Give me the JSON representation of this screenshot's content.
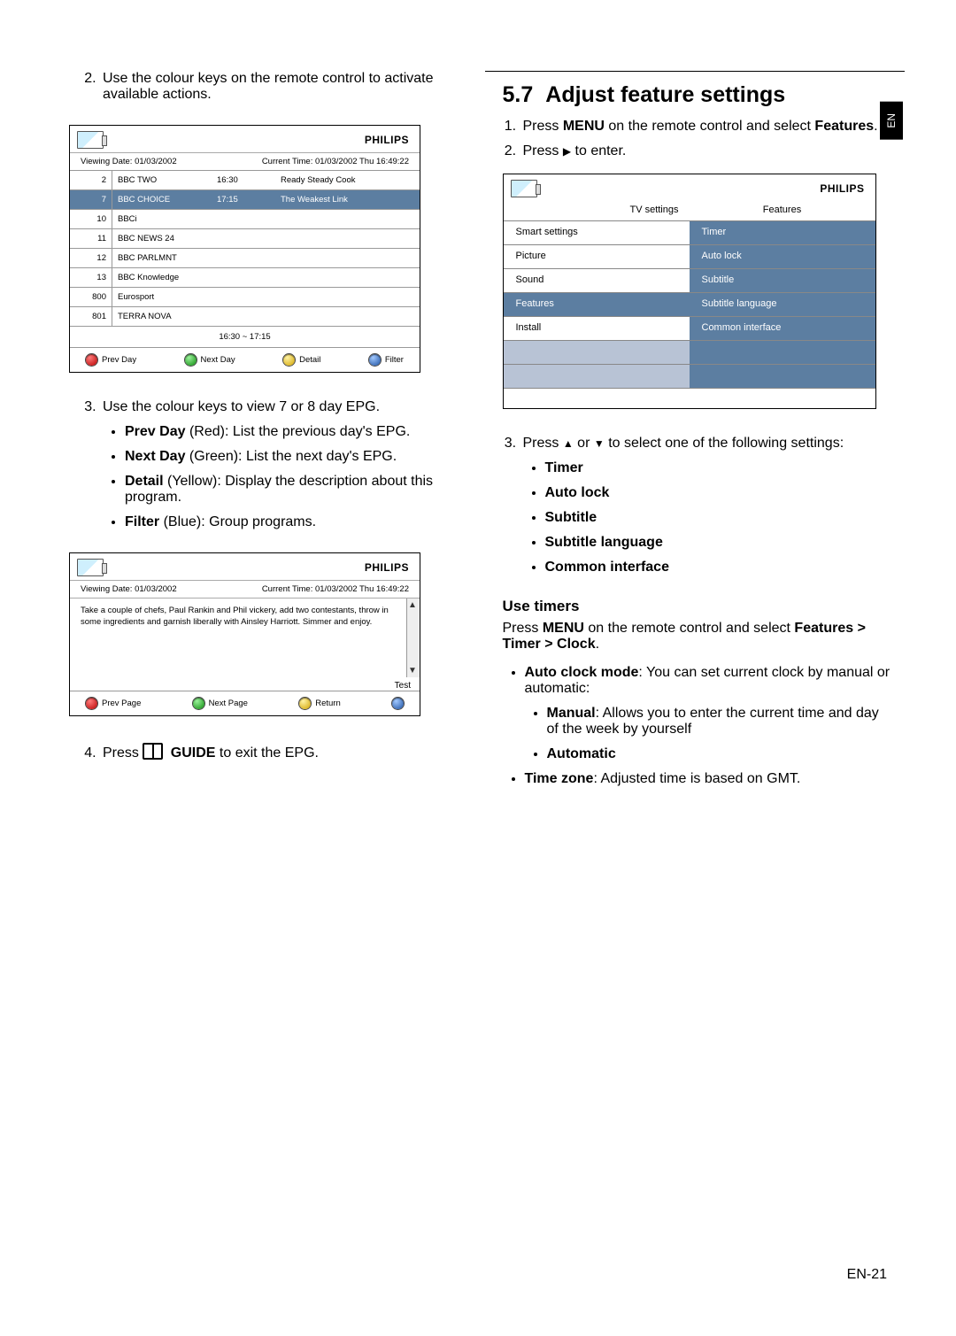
{
  "lang_tab": "EN",
  "footer": "EN-21",
  "left": {
    "step2": "Use the colour keys on the remote control to activate available actions.",
    "step3": "Use the colour keys to view 7 or 8 day EPG.",
    "prev_day_b": "Prev Day",
    "prev_day_t": " (Red): List the previous day's EPG.",
    "next_day_b": "Next Day",
    "next_day_t": " (Green): List the next day's EPG.",
    "detail_b": "Detail",
    "detail_t": " (Yellow): Display the description about this program.",
    "filter_b": "Filter",
    "filter_t": " (Blue): Group programs.",
    "step4_pre": "Press ",
    "step4_b": " GUIDE",
    "step4_post": " to exit the EPG."
  },
  "epg": {
    "brand": "PHILIPS",
    "viewing": "Viewing Date: 01/03/2002",
    "current": "Current Time: 01/03/2002 Thu 16:49:22",
    "channels": [
      {
        "num": "2",
        "name": "BBC TWO",
        "time": "16:30",
        "prog": "Ready Steady Cook"
      },
      {
        "num": "7",
        "name": "BBC CHOICE",
        "time": "17:15",
        "prog": "The Weakest Link"
      },
      {
        "num": "10",
        "name": "BBCi",
        "time": "",
        "prog": ""
      },
      {
        "num": "11",
        "name": "BBC NEWS 24",
        "time": "",
        "prog": ""
      },
      {
        "num": "12",
        "name": "BBC PARLMNT",
        "time": "",
        "prog": ""
      },
      {
        "num": "13",
        "name": "BBC Knowledge",
        "time": "",
        "prog": ""
      },
      {
        "num": "800",
        "name": "Eurosport",
        "time": "",
        "prog": ""
      },
      {
        "num": "801",
        "name": "TERRA NOVA",
        "time": "",
        "prog": ""
      }
    ],
    "range": "16:30 ~ 17:15",
    "btn_prev": "Prev Day",
    "btn_next": "Next Day",
    "btn_detail": "Detail",
    "btn_filter": "Filter"
  },
  "epg2": {
    "desc": "Take a couple of chefs, Paul Rankin and Phil vickery, add two contestants, throw in some ingredients and garnish liberally with Ainsley Harriott. Simmer and enjoy.",
    "test_label": "Test",
    "btn_prev": "Prev Page",
    "btn_next": "Next Page",
    "btn_ret": "Return"
  },
  "right": {
    "sec_num": "5.7",
    "sec_title": "Adjust feature settings",
    "s1_a": "Press ",
    "s1_b": "MENU",
    "s1_c": " on the remote control and select ",
    "s1_d": "Features",
    "s1_e": ".",
    "s2": "Press ",
    "s2_post": " to enter.",
    "s3_a": "Press ",
    "s3_b": " or ",
    "s3_c": " to select one of the following settings:",
    "opt_timer": "Timer",
    "opt_auto": "Auto lock",
    "opt_sub": "Subtitle",
    "opt_sublang": "Subtitle language",
    "opt_ci": "Common interface",
    "use_timers": "Use timers",
    "ut_1": "Press ",
    "ut_2": "MENU",
    "ut_3": " on the remote control and select ",
    "ut_4": "Features > Timer > Clock",
    "ut_5": ".",
    "acm_b": "Auto clock mode",
    "acm_t": ": You can set current clock by manual or automatic:",
    "man_b": "Manual",
    "man_t": ": Allows you to enter the current time and day of the week by yourself",
    "auto_b": "Automatic",
    "tz_b": "Time zone",
    "tz_t": ": Adjusted time is based on GMT."
  },
  "menu": {
    "brand": "PHILIPS",
    "h_left": "TV settings",
    "h_right": "Features",
    "left_items": [
      "Smart settings",
      "Picture",
      "Sound",
      "Features",
      "Install"
    ],
    "right_items": [
      "Timer",
      "Auto lock",
      "Subtitle",
      "Subtitle language",
      "Common interface"
    ]
  }
}
